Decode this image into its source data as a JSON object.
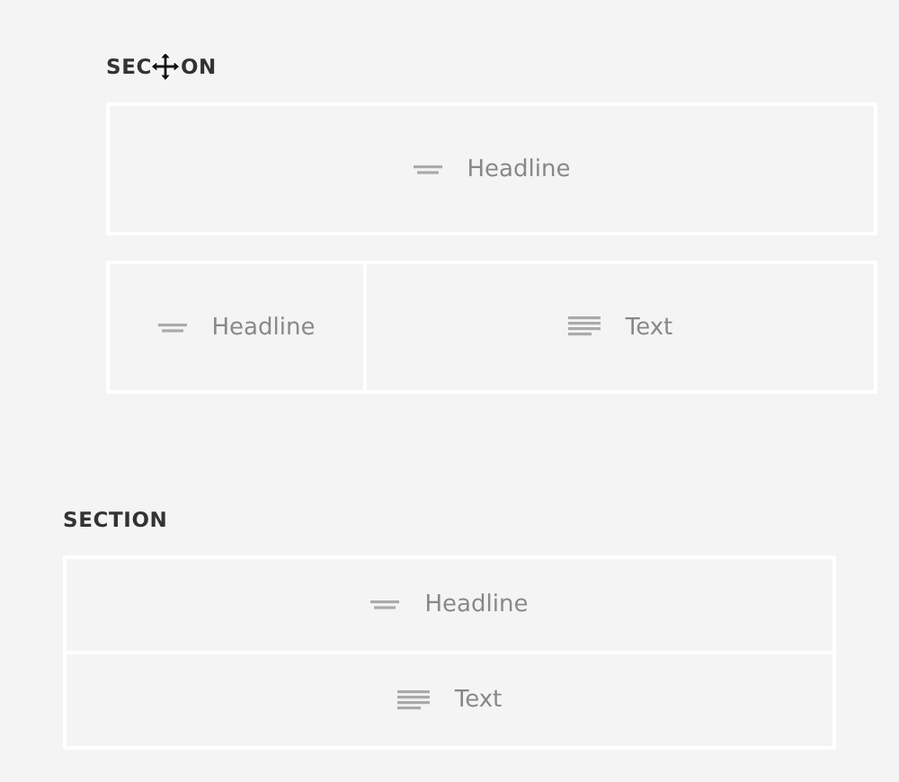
{
  "sections": [
    {
      "label": [
        "SEC",
        "ON"
      ],
      "cursor_over_label": true,
      "rows_spaced": true,
      "rows": [
        {
          "cells": [
            {
              "kind": "headline",
              "label": "Headline"
            }
          ]
        },
        {
          "cells": [
            {
              "kind": "headline",
              "label": "Headline"
            },
            {
              "kind": "text",
              "label": "Text"
            }
          ]
        }
      ]
    },
    {
      "label": [
        "SECTION"
      ],
      "cursor_over_label": false,
      "rows_spaced": false,
      "rows": [
        {
          "cells": [
            {
              "kind": "headline",
              "label": "Headline"
            }
          ]
        },
        {
          "cells": [
            {
              "kind": "text",
              "label": "Text"
            }
          ]
        }
      ]
    }
  ]
}
